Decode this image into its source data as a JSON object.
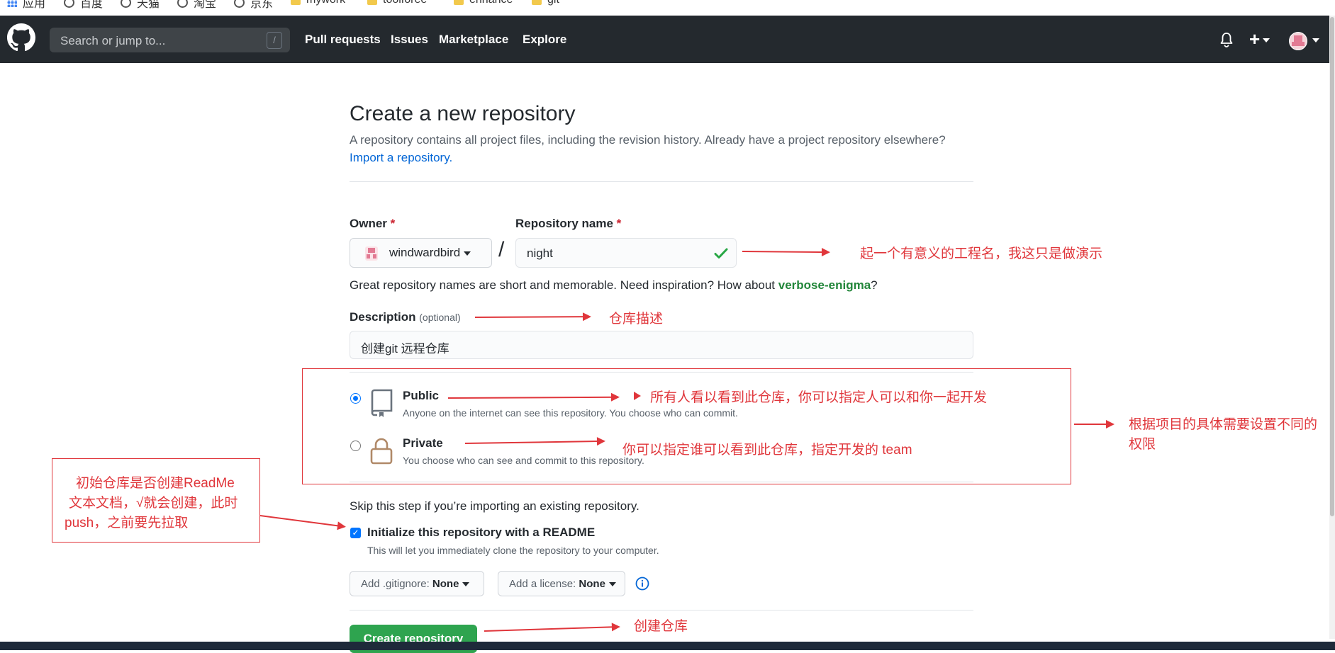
{
  "bookmarks": [
    {
      "label": "应用",
      "icon": "apps-icon"
    },
    {
      "label": "百度",
      "icon": "globe-icon"
    },
    {
      "label": "天猫",
      "icon": "globe-icon"
    },
    {
      "label": "淘宝",
      "icon": "globe-icon"
    },
    {
      "label": "京东",
      "icon": "globe-icon"
    },
    {
      "label": "mywork",
      "icon": "folder-icon"
    },
    {
      "label": "toolforee",
      "icon": "folder-icon"
    },
    {
      "label": "enhance",
      "icon": "folder-icon"
    },
    {
      "label": "git",
      "icon": "folder-icon"
    }
  ],
  "header": {
    "search_placeholder": "Search or jump to...",
    "search_shortcut": "/",
    "nav": [
      "Pull requests",
      "Issues",
      "Marketplace",
      "Explore"
    ],
    "plus": "+",
    "colors": {
      "bg": "#24292e"
    }
  },
  "page": {
    "title": "Create a new repository",
    "subtitle": "A repository contains all project files, including the revision history. Already have a project repository elsewhere?",
    "import_link": "Import a repository.",
    "owner_label": "Owner",
    "required_mark": "*",
    "owner_value": "windwardbird",
    "slash": "/",
    "repo_label": "Repository name",
    "repo_value": "night",
    "hint_prefix": "Great repository names are short and memorable. Need inspiration? How about ",
    "hint_suggestion": "verbose-enigma",
    "hint_suffix": "?",
    "desc_label": "Description",
    "desc_optional": "(optional)",
    "desc_value": "创建git 远程仓库",
    "public_title": "Public",
    "public_desc": "Anyone on the internet can see this repository. You choose who can commit.",
    "private_title": "Private",
    "private_desc": "You choose who can see and commit to this repository.",
    "skip_text": "Skip this step if you’re importing an existing repository.",
    "readme_label": "Initialize this repository with a README",
    "readme_desc": "This will let you immediately clone the repository to your computer.",
    "gitignore_label": "Add .gitignore:",
    "gitignore_value": "None",
    "license_label": "Add a license:",
    "license_value": "None",
    "create_button": "Create repository",
    "accent_color": "#2ea44f"
  },
  "annotations": {
    "repo_name_note": "起一个有意义的工程名，我这只是做演示",
    "desc_note": "仓库描述",
    "public_note": "所有人看以看到此仓库，你可以指定人可以和你一起开发",
    "private_note": "你可以指定谁可以看到此仓库，指定开发的 team",
    "visibility_note_line1": "根据项目的具体需要设置不同的",
    "visibility_note_line2": "权限",
    "readme_note_line1": "初始仓库是否创建ReadMe",
    "readme_note_line2": "文本文档，√就会创建，此时",
    "readme_note_line3": "push，之前要先拉取",
    "create_note": "创建仓库",
    "annotation_color": "#e0363b"
  }
}
